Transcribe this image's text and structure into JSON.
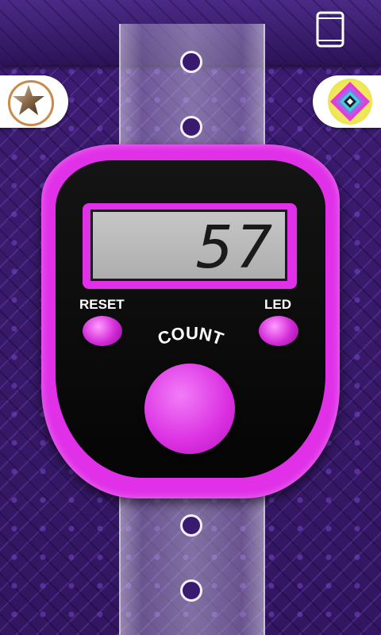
{
  "toolbar": {
    "rate_icon": "star-icon",
    "theme_icon": "diamond-pattern-icon",
    "orientation_icon": "phone-icon"
  },
  "counter": {
    "display_value": "57",
    "reset_label": "RESET",
    "led_label": "LED",
    "count_label": "COUNT"
  },
  "colors": {
    "device": "#e030e8",
    "background": "#3a1a6e",
    "lcd": "#b8b8b8"
  }
}
